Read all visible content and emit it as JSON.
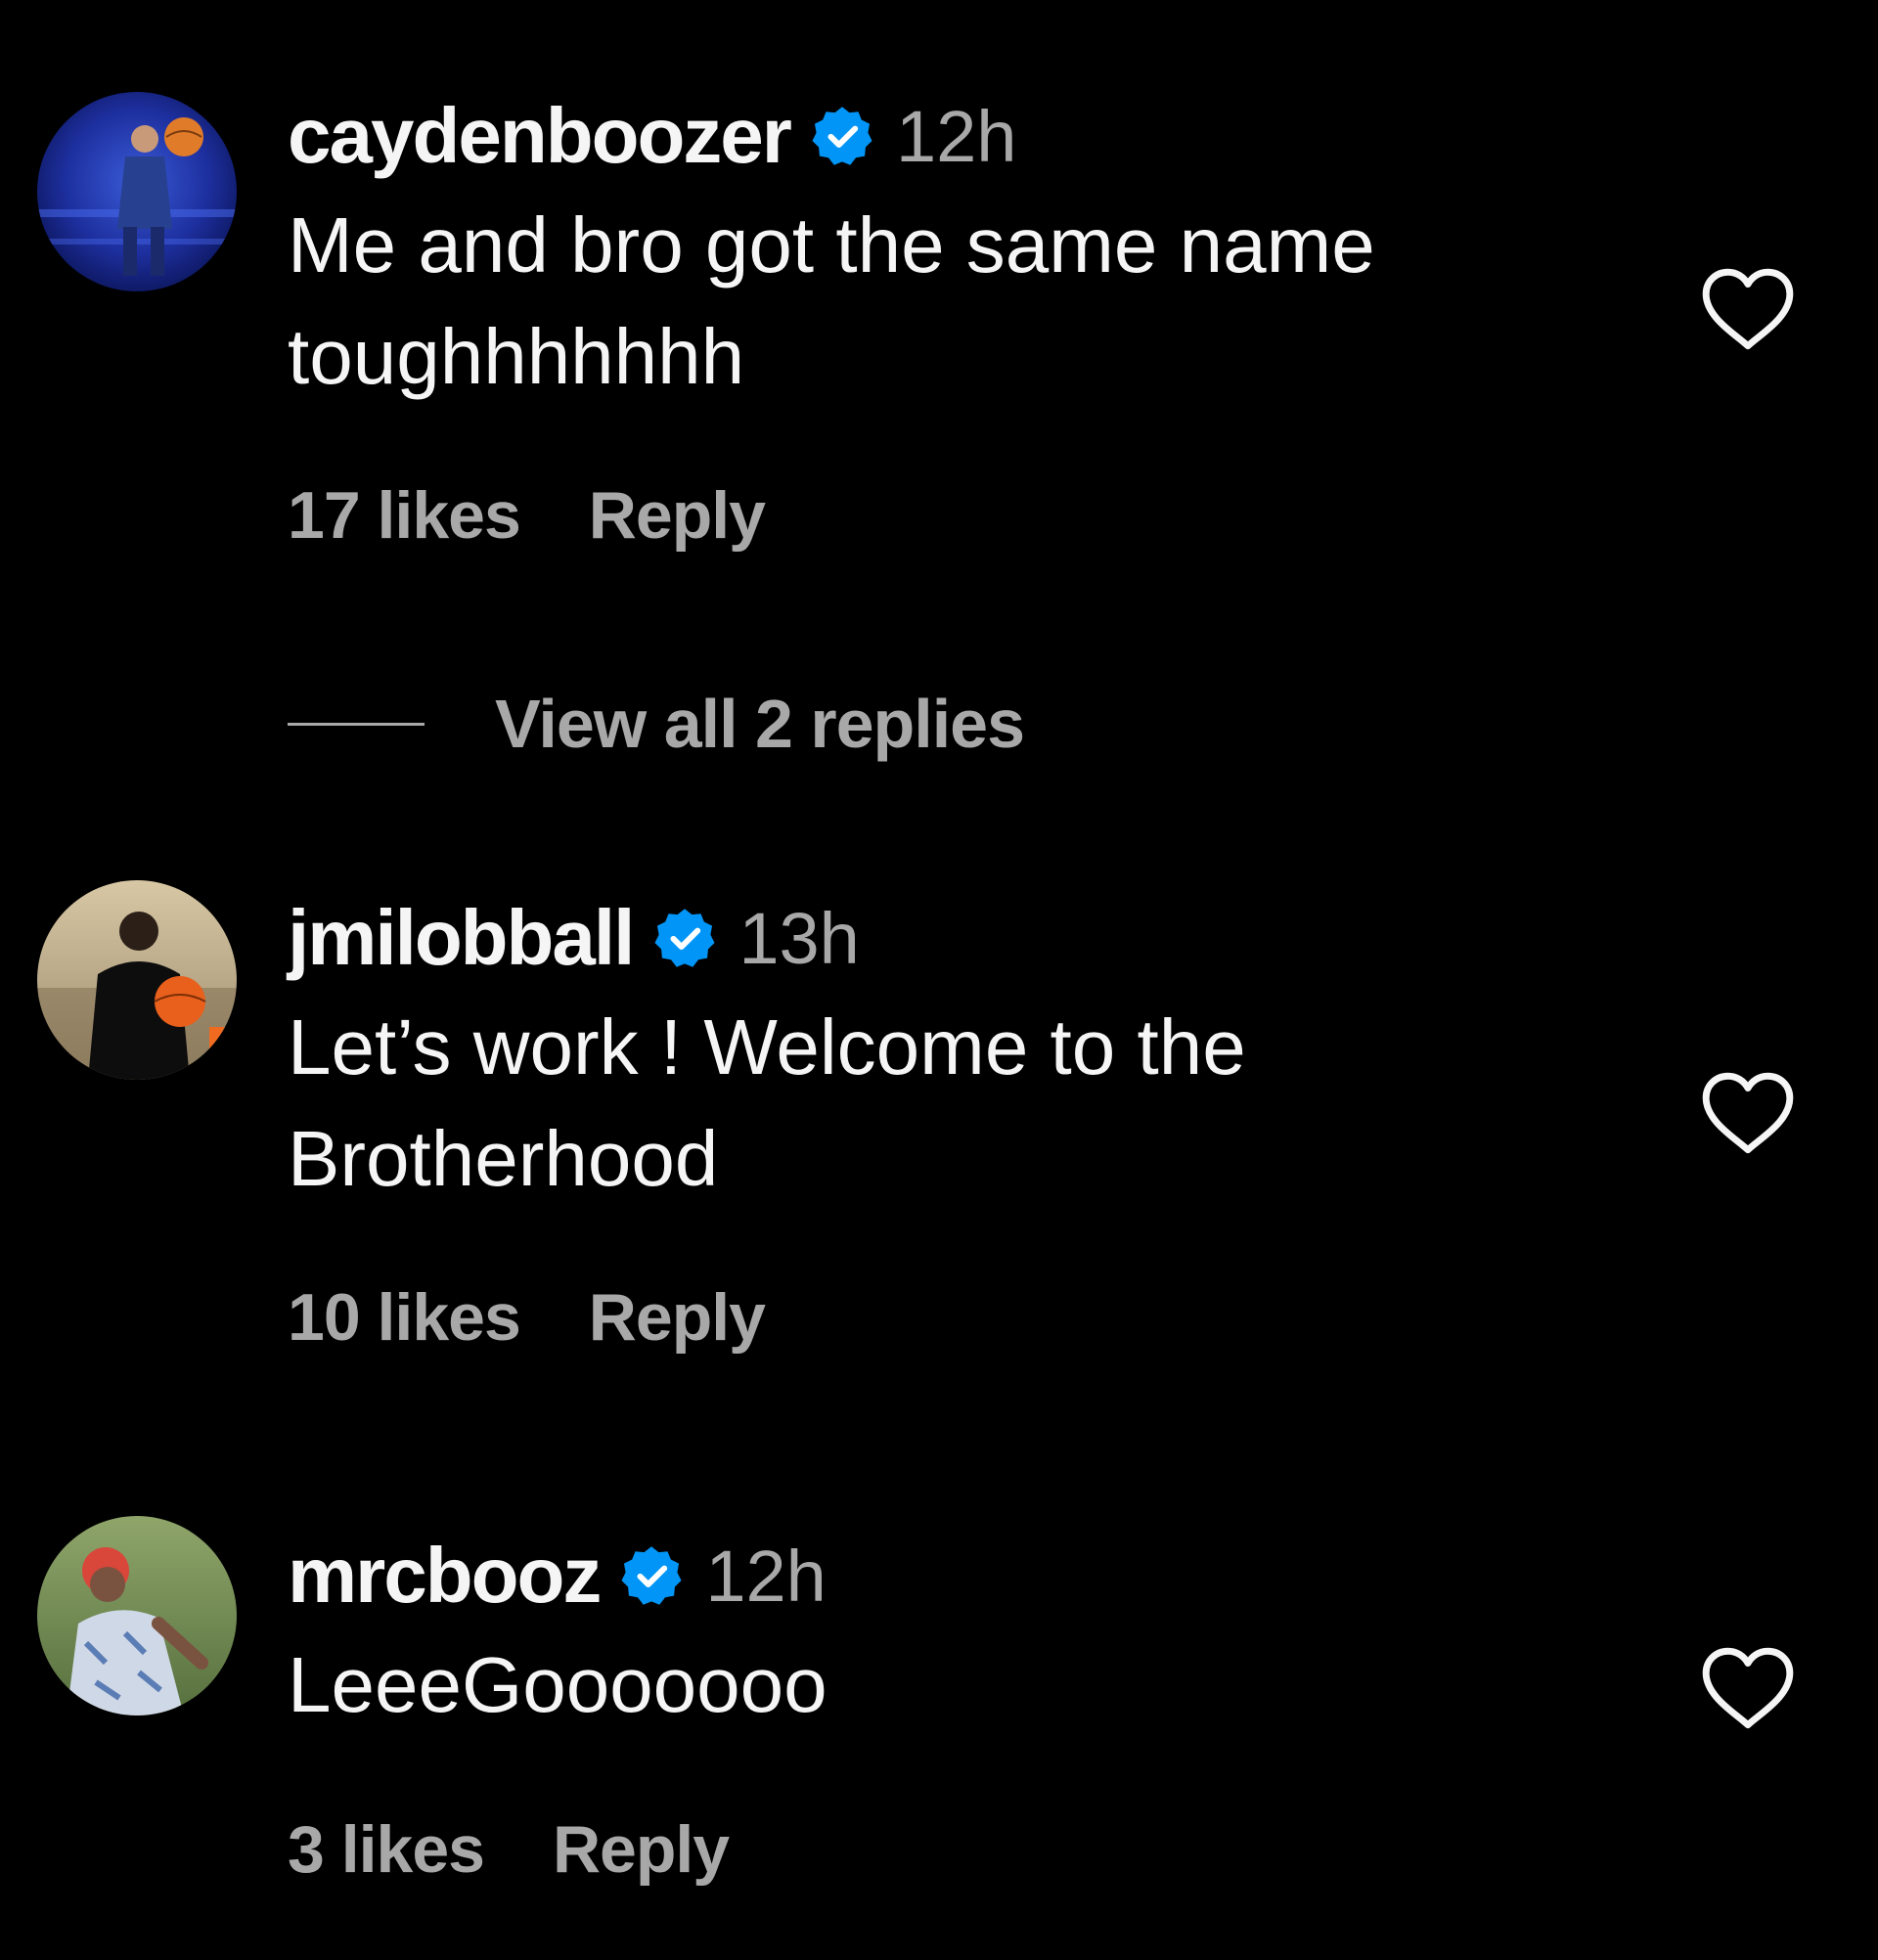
{
  "colors": {
    "background": "#000000",
    "primary_text": "#f5f5f5",
    "secondary_text": "#a8a8a8",
    "verified_badge": "#0095f6"
  },
  "comments": [
    {
      "username": "caydenboozer",
      "verified": true,
      "time": "12h",
      "text_lines": [
        "Me and bro got the same name",
        "toughhhhhhh"
      ],
      "likes": "17 likes",
      "reply_label": "Reply",
      "avatar_icon": "avatar-basketball-player-icon"
    },
    {
      "username": "jmilobball",
      "verified": true,
      "time": "13h",
      "text_lines": [
        "Let’s work ! Welcome to the",
        "Brotherhood"
      ],
      "likes": "10 likes",
      "reply_label": "Reply",
      "avatar_icon": "avatar-coach-icon"
    },
    {
      "username": "mrcbooz",
      "verified": true,
      "time": "12h",
      "text_lines": [
        "LeeeGooooooo"
      ],
      "likes": "3 likes",
      "reply_label": "Reply",
      "avatar_icon": "avatar-person-outdoors-icon"
    }
  ],
  "view_replies": {
    "label": "View all 2 replies"
  },
  "icons": {
    "like": "heart-outline-icon",
    "verified": "verified-badge-icon"
  }
}
